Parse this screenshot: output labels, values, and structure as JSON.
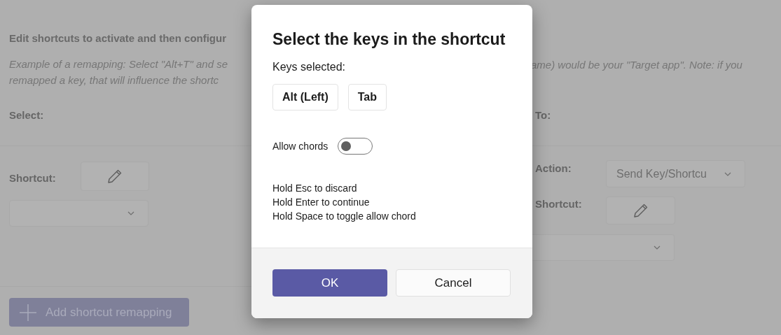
{
  "page": {
    "intro_left": "Edit shortcuts to activate and then configur",
    "example_left": [
      "Example of a remapping: Select \"Alt+T\" and se",
      "remapped a key, that will influence the shortc"
    ],
    "example_right": "ame) would be your \"Target app\". Note: if you",
    "select_heading": "Select:",
    "to_heading": "To:",
    "left_shortcut_label": "Shortcut:",
    "action_label": "Action:",
    "action_value": "Send Key/Shortcu",
    "right_shortcut_label": "Shortcut:",
    "add_button": "Add shortcut remapping"
  },
  "dialog": {
    "title": "Select the keys in the shortcut",
    "keys_label": "Keys selected:",
    "keys": [
      "Alt (Left)",
      "Tab"
    ],
    "allow_chords": {
      "label": "Allow chords",
      "on": false
    },
    "hints": [
      "Hold Esc to discard",
      "Hold Enter to continue",
      "Hold Space to toggle allow chord"
    ],
    "buttons": [
      {
        "label": "OK",
        "kind": "primary"
      },
      {
        "label": "Cancel",
        "kind": "secondary"
      }
    ]
  }
}
